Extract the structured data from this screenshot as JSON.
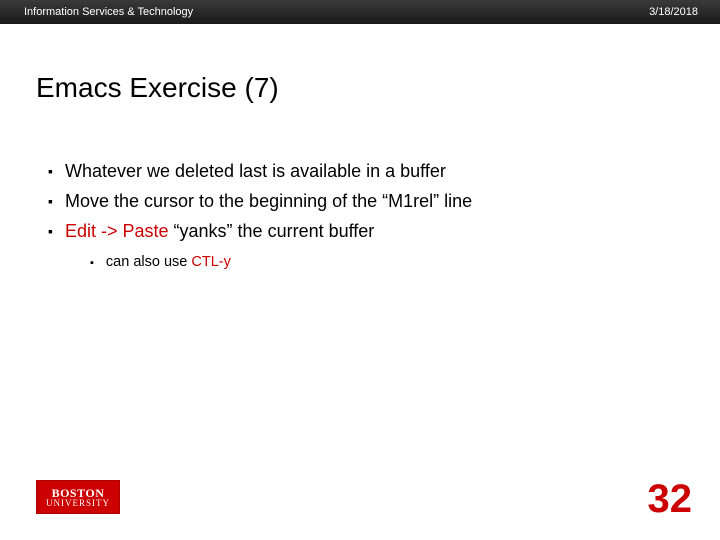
{
  "header": {
    "org": "Information Services & Technology",
    "date": "3/18/2018"
  },
  "title": "Emacs Exercise (7)",
  "bullets": [
    {
      "text": "Whatever we deleted last is available in a buffer",
      "redParts": []
    },
    {
      "text": "Move the cursor to the beginning of the “M1rel” line",
      "redParts": []
    },
    {
      "prefix": "",
      "parts": [
        {
          "t": "Edit -> Paste",
          "red": true
        },
        {
          "t": " “yanks” the current buffer",
          "red": false
        }
      ]
    }
  ],
  "subBullets": [
    {
      "parts": [
        {
          "t": "can also use ",
          "red": false
        },
        {
          "t": "CTL-y",
          "red": true
        }
      ]
    }
  ],
  "logo": {
    "line1": "BOSTON",
    "line2": "UNIVERSITY"
  },
  "pageNumber": "32"
}
